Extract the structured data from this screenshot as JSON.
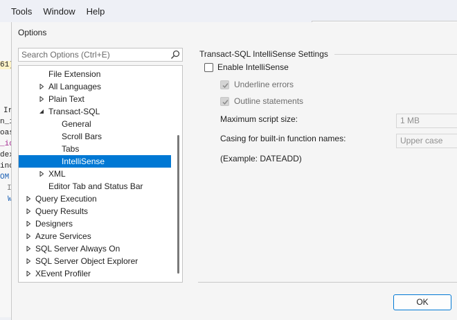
{
  "menubar": {
    "items": [
      "Tools",
      "Window",
      "Help"
    ]
  },
  "background_code": [
    "61)",
    "Ir",
    "n_i",
    "oas",
    "_id",
    "dex",
    "ind",
    "OM",
    "I",
    "W"
  ],
  "dialog": {
    "title": "Options"
  },
  "search": {
    "placeholder": "Search Options (Ctrl+E)",
    "icon": "search-icon"
  },
  "tree": {
    "items": [
      {
        "label": "File Extension",
        "level": 2,
        "arrow": "none",
        "selected": false
      },
      {
        "label": "All Languages",
        "level": 2,
        "arrow": "right",
        "selected": false
      },
      {
        "label": "Plain Text",
        "level": 2,
        "arrow": "right",
        "selected": false
      },
      {
        "label": "Transact-SQL",
        "level": 2,
        "arrow": "down",
        "selected": false
      },
      {
        "label": "General",
        "level": 3,
        "arrow": "none",
        "selected": false
      },
      {
        "label": "Scroll Bars",
        "level": 3,
        "arrow": "none",
        "selected": false
      },
      {
        "label": "Tabs",
        "level": 3,
        "arrow": "none",
        "selected": false
      },
      {
        "label": "IntelliSense",
        "level": 3,
        "arrow": "none",
        "selected": true
      },
      {
        "label": "XML",
        "level": 2,
        "arrow": "right",
        "selected": false
      },
      {
        "label": "Editor Tab and Status Bar",
        "level": 2,
        "arrow": "none",
        "selected": false
      },
      {
        "label": "Query Execution",
        "level": 1,
        "arrow": "right",
        "selected": false
      },
      {
        "label": "Query Results",
        "level": 1,
        "arrow": "right",
        "selected": false
      },
      {
        "label": "Designers",
        "level": 1,
        "arrow": "right",
        "selected": false
      },
      {
        "label": "Azure Services",
        "level": 1,
        "arrow": "right",
        "selected": false
      },
      {
        "label": "SQL Server Always On",
        "level": 1,
        "arrow": "right",
        "selected": false
      },
      {
        "label": "SQL Server Object Explorer",
        "level": 1,
        "arrow": "right",
        "selected": false
      },
      {
        "label": "XEvent Profiler",
        "level": 1,
        "arrow": "right",
        "selected": false
      }
    ]
  },
  "settings": {
    "group_title": "Transact-SQL IntelliSense Settings",
    "enable_intellisense": {
      "label": "Enable IntelliSense",
      "checked": false
    },
    "underline_errors": {
      "label": "Underline errors",
      "checked": true,
      "enabled": false
    },
    "outline_statements": {
      "label": "Outline statements",
      "checked": true,
      "enabled": false
    },
    "max_script_size": {
      "label": "Maximum script size:",
      "value": "1 MB"
    },
    "casing": {
      "label": "Casing for built-in function names:",
      "value": "Upper case"
    },
    "example": "(Example: DATEADD)"
  },
  "buttons": {
    "ok": "OK"
  },
  "colors": {
    "selection": "#0078d4",
    "ok_border": "#0078d4"
  }
}
